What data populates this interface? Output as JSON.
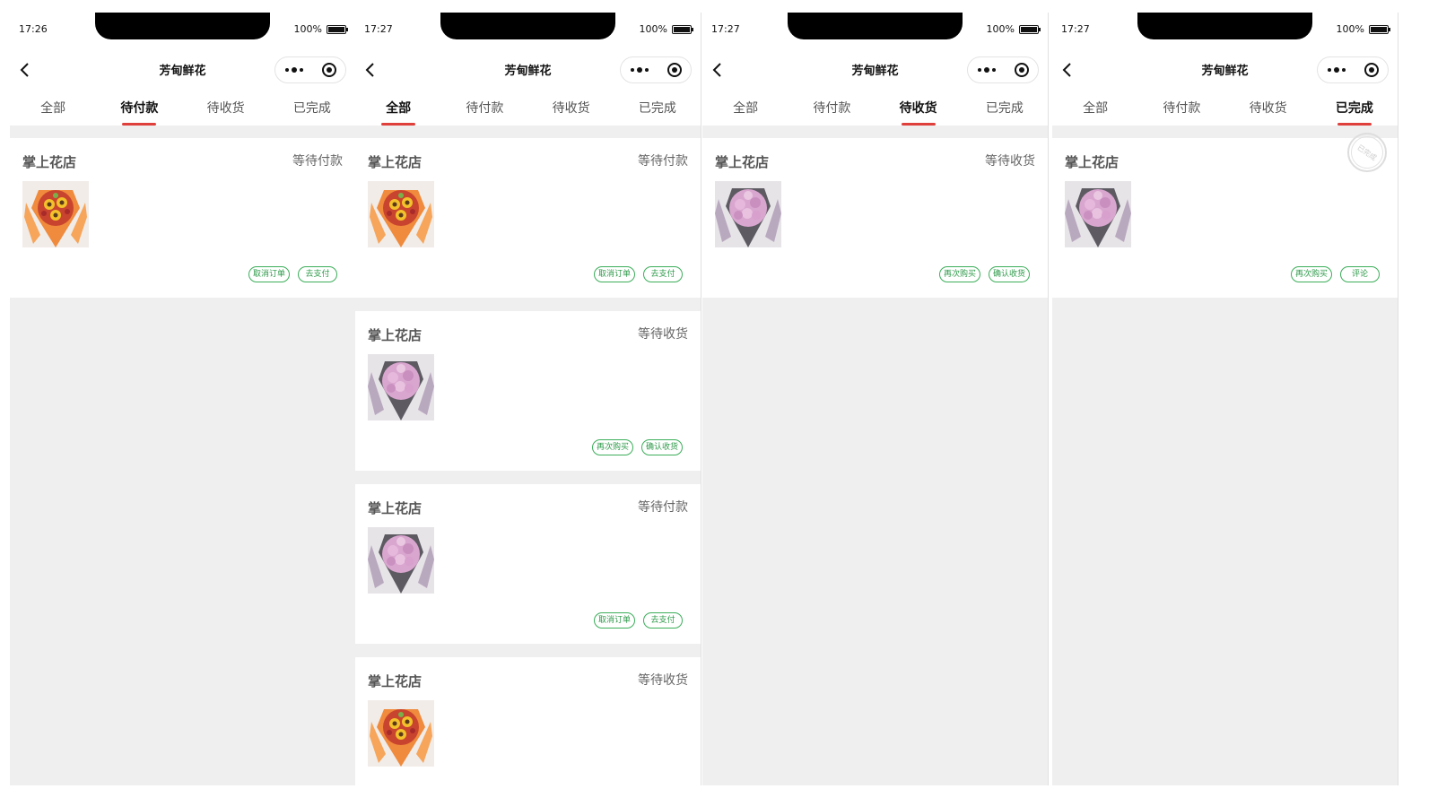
{
  "screens": [
    {
      "time": "17:26",
      "battery": "100%",
      "title": "芳甸鲜花",
      "tabs": [
        "全部",
        "待付款",
        "待收货",
        "已完成"
      ],
      "active_tab": 1,
      "orders": [
        {
          "shop": "掌上花店",
          "status": "等待付款",
          "image": "sunflower-bouquet",
          "buttons": [
            "取消订单",
            "去支付"
          ]
        }
      ]
    },
    {
      "time": "17:27",
      "battery": "100%",
      "title": "芳甸鲜花",
      "tabs": [
        "全部",
        "待付款",
        "待收货",
        "已完成"
      ],
      "active_tab": 0,
      "orders": [
        {
          "shop": "掌上花店",
          "status": "等待付款",
          "image": "sunflower-bouquet",
          "buttons": [
            "取消订单",
            "去支付"
          ]
        },
        {
          "shop": "掌上花店",
          "status": "等待收货",
          "image": "pink-bouquet",
          "buttons": [
            "再次购买",
            "确认收货"
          ]
        },
        {
          "shop": "掌上花店",
          "status": "等待付款",
          "image": "pink-bouquet",
          "buttons": [
            "取消订单",
            "去支付"
          ]
        },
        {
          "shop": "掌上花店",
          "status": "等待收货",
          "image": "sunflower-bouquet",
          "buttons": []
        }
      ]
    },
    {
      "time": "17:27",
      "battery": "100%",
      "title": "芳甸鲜花",
      "tabs": [
        "全部",
        "待付款",
        "待收货",
        "已完成"
      ],
      "active_tab": 2,
      "orders": [
        {
          "shop": "掌上花店",
          "status": "等待收货",
          "image": "pink-bouquet",
          "buttons": [
            "再次购买",
            "确认收货"
          ]
        }
      ]
    },
    {
      "time": "17:27",
      "battery": "100%",
      "title": "芳甸鲜花",
      "tabs": [
        "全部",
        "待付款",
        "待收货",
        "已完成"
      ],
      "active_tab": 3,
      "orders": [
        {
          "shop": "掌上花店",
          "status": "",
          "stamp": "已完成",
          "image": "pink-bouquet",
          "buttons": [
            "再次购买",
            "评论"
          ]
        }
      ]
    }
  ],
  "colors": {
    "accent_red": "#e0403c",
    "button_green": "#3cae5a",
    "background": "#efefef"
  }
}
